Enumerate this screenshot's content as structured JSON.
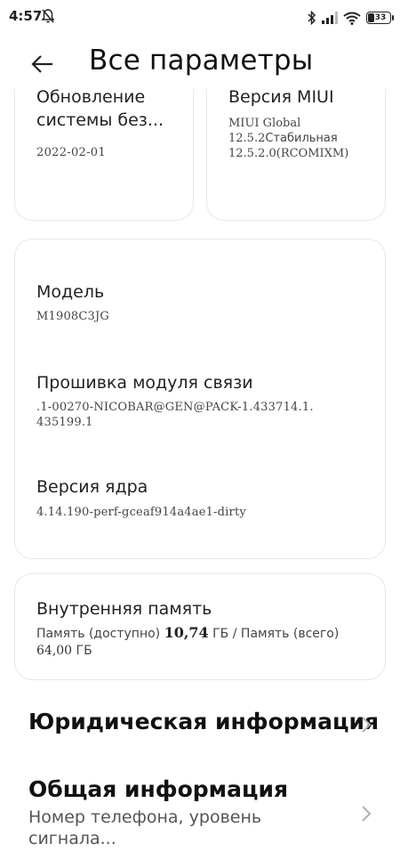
{
  "status_bar": {
    "time": "4:57",
    "battery_level": "33",
    "icons": [
      "mute-notifications-icon",
      "bluetooth-icon",
      "signal-icon",
      "wifi-icon",
      "battery-icon"
    ]
  },
  "header": {
    "title": "Все параметры",
    "back_icon": "back-arrow-icon"
  },
  "tiles": {
    "system_update": {
      "title": "Обновление\nсистемы без...",
      "date": "2022-02-01"
    },
    "miui_version": {
      "title": "Версия MIUI",
      "line1": "MIUI Global",
      "line2_num": "12.5.2",
      "line2_text": "Стабильная",
      "line3": "12.5.2.0(RCOMIXM)"
    }
  },
  "specs": {
    "model_label": "Модель",
    "model_value": "M1908C3JG",
    "baseband_label": "Прошивка модуля связи",
    "baseband_value_line1": ".1-00270-NICOBAR@GEN@PACK-1.433714.1.",
    "baseband_value_line2": "435199.1",
    "kernel_label": "Версия ядра",
    "kernel_value": "4.14.190-perf-gceaf914a4ae1-dirty"
  },
  "storage": {
    "label": "Внутренняя память",
    "available_label": "Память (доступно)",
    "available_value": "10,74",
    "unit1": "ГБ",
    "separator": "/",
    "total_label": "Память (всего)",
    "total_value": "64,00",
    "unit2": "ГБ"
  },
  "menu": {
    "legal": {
      "title": "Юридическая информация"
    },
    "general": {
      "title": "Общая информация",
      "subtitle": "Номер телефона, уровень сигнала..."
    }
  },
  "colors": {
    "background": "#ffffff",
    "card_border": "#e8e8e8",
    "primary_text": "#111111",
    "secondary_text": "#444444",
    "chevron": "#b0b0b0"
  }
}
